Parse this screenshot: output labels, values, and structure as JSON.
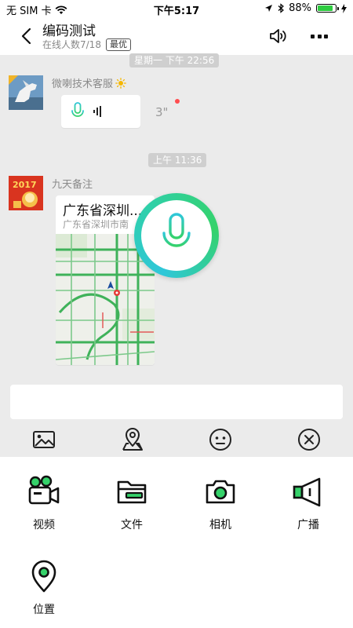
{
  "status_bar": {
    "carrier": "无 SIM 卡",
    "time": "下午5:17",
    "battery": "88%",
    "battery_level": 0.88
  },
  "header": {
    "title": "编码测试",
    "online": "在线人数7/18",
    "badge": "最优"
  },
  "messages": [
    {
      "timestamp": "星期一 下午 22:56",
      "sender": "微喇技术客服",
      "type": "voice",
      "duration": "3\"",
      "unread": true
    },
    {
      "timestamp": "上午 11:36",
      "sender": "九天备注",
      "type": "location",
      "title": "广东省深圳...",
      "address": "广东省深圳市南"
    }
  ],
  "toolbar": {
    "icons": [
      "image-icon",
      "location-pin-icon",
      "emoji-icon",
      "close-circle-icon"
    ]
  },
  "panel": {
    "items": [
      {
        "label": "视频",
        "icon": "video-camera-icon"
      },
      {
        "label": "文件",
        "icon": "folder-icon"
      },
      {
        "label": "相机",
        "icon": "camera-icon"
      },
      {
        "label": "广播",
        "icon": "megaphone-icon"
      },
      {
        "label": "位置",
        "icon": "location-icon"
      }
    ]
  },
  "colors": {
    "accent": "#2ecc71",
    "chat_bg": "#ebebeb",
    "mic_gradient_start": "#2fc7d9",
    "mic_gradient_end": "#35d26a",
    "unread": "#ff4d4f"
  }
}
